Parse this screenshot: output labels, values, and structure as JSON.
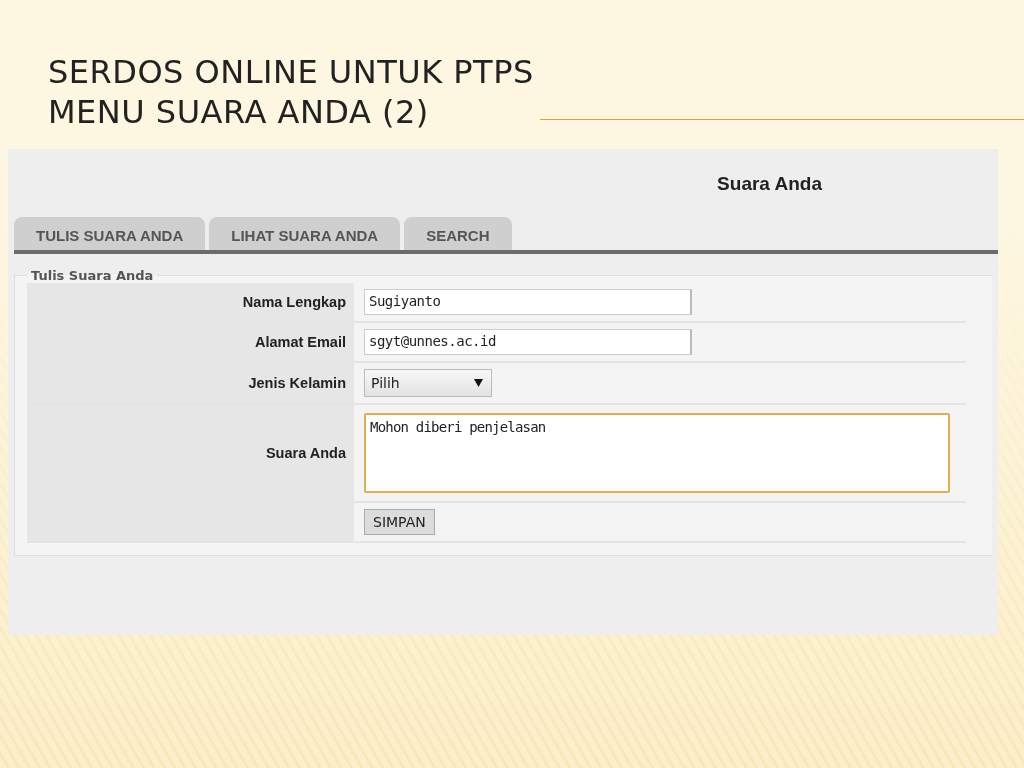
{
  "slide": {
    "title_lines": [
      "SERDOS ONLINE UNTUK PTPS",
      "MENU SUARA ANDA (2)"
    ]
  },
  "page": {
    "heading": "Suara Anda",
    "tabs": [
      {
        "label": "TULIS SUARA ANDA",
        "selected": false
      },
      {
        "label": "LIHAT SUARA ANDA",
        "selected": false
      },
      {
        "label": "SEARCH",
        "selected": false
      }
    ],
    "fieldset": {
      "legend": "Tulis Suara Anda",
      "rows": [
        {
          "kind": "text",
          "label": "Nama Lengkap",
          "value": "Sugiyanto"
        },
        {
          "kind": "text",
          "label": "Alamat Email",
          "value": "sgyt@unnes.ac.id"
        },
        {
          "kind": "select",
          "label": "Jenis Kelamin",
          "value": "Pilih"
        },
        {
          "kind": "textarea",
          "label": "Suara Anda",
          "value": "Mohon diberi penjelasan",
          "focused": true
        },
        {
          "kind": "button",
          "value": "SIMPAN"
        }
      ]
    }
  }
}
